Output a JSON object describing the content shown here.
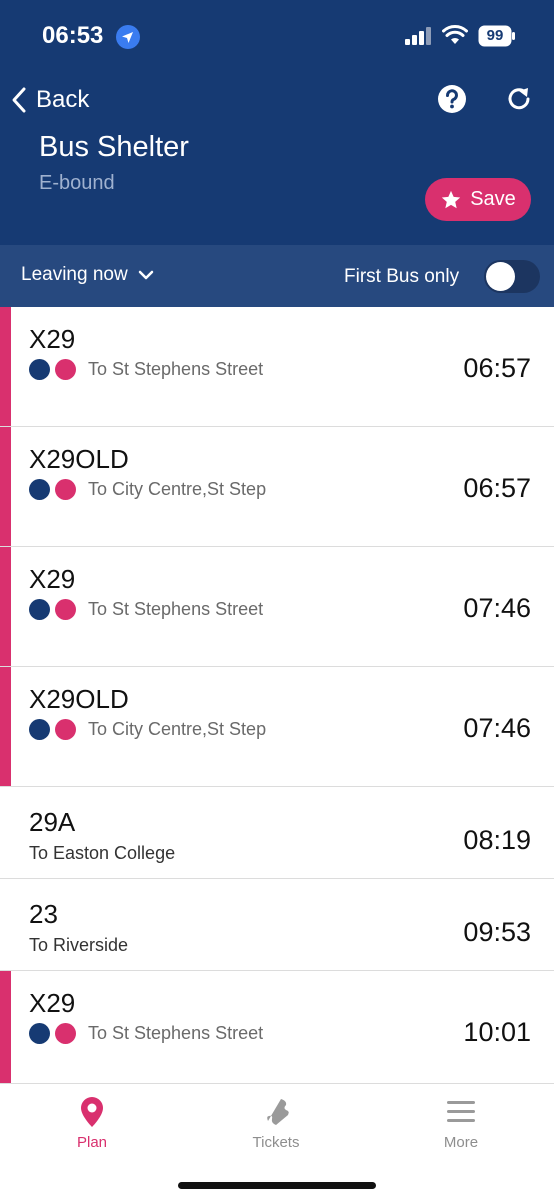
{
  "status": {
    "time": "06:53",
    "battery": "99"
  },
  "nav": {
    "back_label": "Back"
  },
  "stop": {
    "name": "Bus Shelter",
    "direction": "E-bound"
  },
  "save_label": "Save",
  "filters": {
    "leaving_label": "Leaving now",
    "first_bus_label": "First Bus only",
    "first_bus_only": false
  },
  "departures": [
    {
      "route": "X29",
      "destination": "To St Stephens Street",
      "time": "06:57"
    },
    {
      "route": "X29OLD",
      "destination": "To City Centre,St Step",
      "time": "06:57"
    },
    {
      "route": "X29",
      "destination": "To St Stephens Street",
      "time": "07:46"
    },
    {
      "route": "X29OLD",
      "destination": "To City Centre,St Step",
      "time": "07:46"
    },
    {
      "route": "29A",
      "destination": "To Easton College",
      "time": "08:19"
    },
    {
      "route": "23",
      "destination": "To Riverside",
      "time": "09:53"
    },
    {
      "route": "X29",
      "destination": "To St Stephens Street",
      "time": "10:01"
    }
  ],
  "tabs": [
    {
      "label": "Plan",
      "icon": "map-pin-icon"
    },
    {
      "label": "Tickets",
      "icon": "ticket-icon"
    },
    {
      "label": "More",
      "icon": "menu-icon"
    }
  ],
  "colors": {
    "header": "#163a73",
    "filter_bar": "#27497f",
    "accent": "#d9306e",
    "location": "#3a7cf0"
  }
}
